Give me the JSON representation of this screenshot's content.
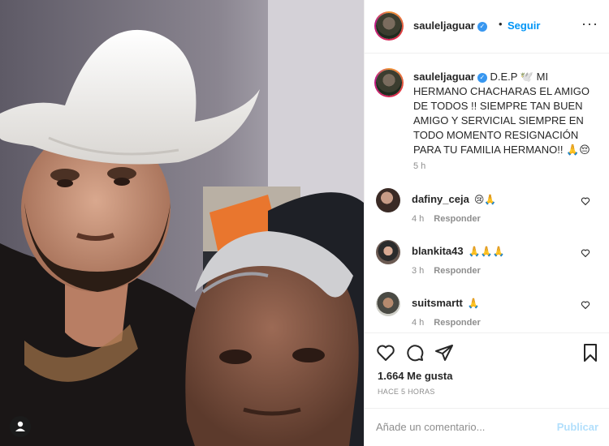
{
  "post": {
    "username": "sauleljaguar",
    "follow_label": "Seguir",
    "dot": "•",
    "caption": "D.E.P 🕊️ MI HERMANO CHACHARAS EL AMIGO DE TODOS !! SIEMPRE TAN BUEN AMIGO Y SERVICIAL SIEMPRE EN TODO MOMENTO RESIGNACIÓN PARA TU FAMILIA HERMANO!! 🙏😔",
    "caption_time": "5 h",
    "likes": "1.664 Me gusta",
    "time_ago": "HACE 5 HORAS"
  },
  "comments": [
    {
      "user": "dafiny_ceja",
      "text": "😢🙏",
      "time": "4 h",
      "reply": "Responder"
    },
    {
      "user": "blankita43",
      "text": "🙏🙏🙏",
      "time": "3 h",
      "reply": "Responder"
    },
    {
      "user": "suitsmartt",
      "text": "🙏",
      "time": "4 h",
      "reply": "Responder"
    }
  ],
  "add_comment": {
    "placeholder": "Añade un comentario...",
    "publish_label": "Publicar"
  },
  "icons": {
    "verified": "verified-badge-icon",
    "more": "more-options-icon",
    "like": "heart-icon",
    "comment": "comment-icon",
    "share": "share-icon",
    "save": "bookmark-icon",
    "tag": "tag-user-icon"
  },
  "colors": {
    "accent": "#0095f6",
    "verified": "#3897f0",
    "muted": "#8e8e8e",
    "publish_disabled": "#b2dffc"
  }
}
